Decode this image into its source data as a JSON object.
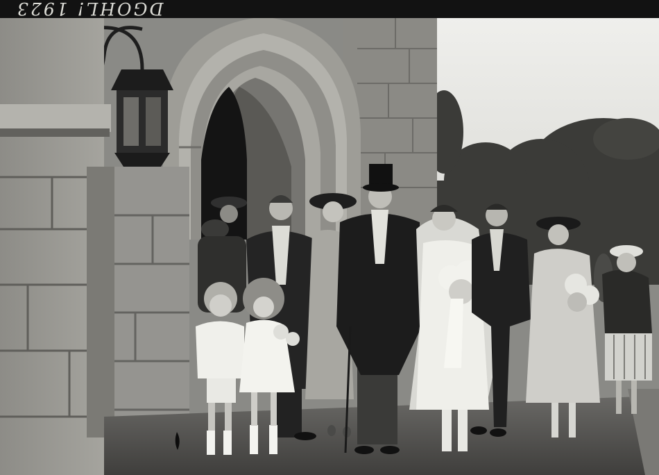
{
  "photo": {
    "negative_caption": "DGOHL! 1923",
    "palette": {
      "sky": "#e6e6e2",
      "stone_light": "#a9a8a2",
      "stone_mid": "#7f7e79",
      "stone_dark": "#4e4d49",
      "doorway": "#161616",
      "path": "#525150",
      "foliage": "#3a3a37",
      "white_dress": "#efefea",
      "dark_suit": "#1e1e1e"
    },
    "figures": [
      "page-boy",
      "flower-girl",
      "groomsman",
      "bridesmaid-left",
      "groom",
      "bride",
      "best-man",
      "bridesmaid-right",
      "guest-right"
    ]
  }
}
